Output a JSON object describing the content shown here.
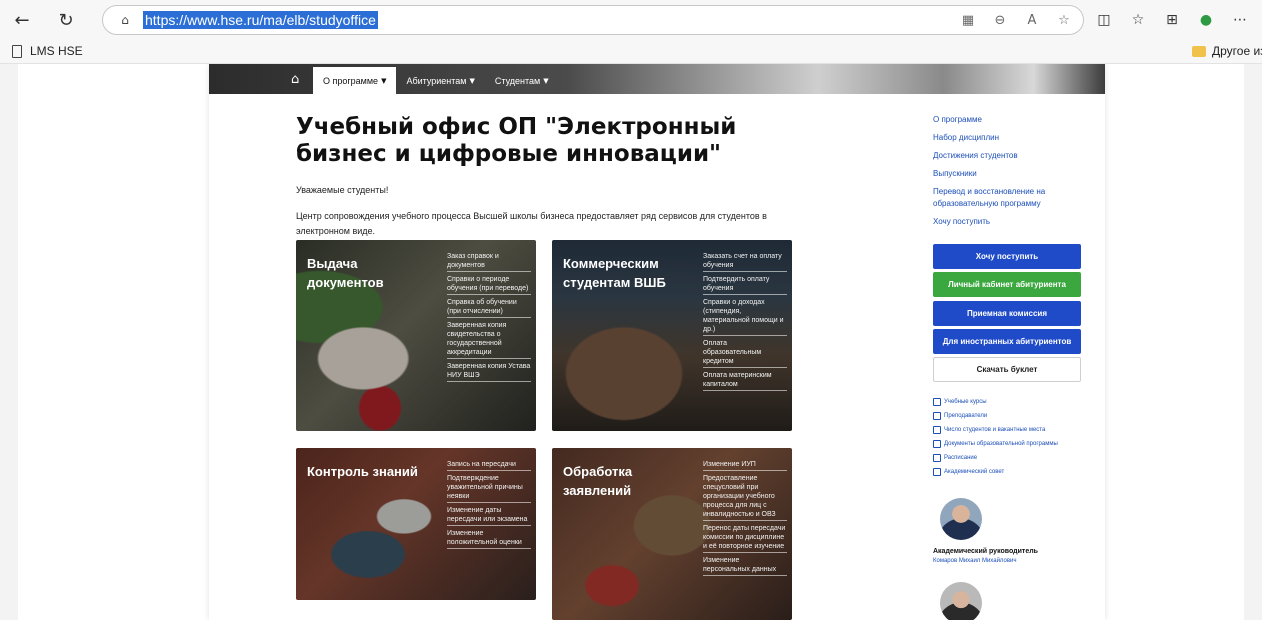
{
  "browser": {
    "url": "https://www.hse.ru/ma/elb/studyoffice",
    "bookmark_left": "LMS HSE",
    "bookmark_right": "Другое изб"
  },
  "site": {
    "nav": {
      "items": [
        {
          "label": "О программе"
        },
        {
          "label": "Абитуриентам"
        },
        {
          "label": "Студентам"
        }
      ]
    },
    "title": "Учебный офис ОП \"Электронный бизнес и цифровые инновации\"",
    "greeting": "Уважаемые студенты!",
    "intro": "Центр сопровождения учебного процесса Высшей школы бизнеса предоставляет ряд сервисов для студентов в электронном виде.",
    "cards": [
      {
        "title": "Выдача документов",
        "links": [
          "Заказ справок и документов",
          "Справки о периоде обучения (при переводе)",
          "Справка об обучении (при отчислении)",
          "Заверенная копия свидетельства о государственной аккредитации",
          "Заверенная копия Устава НИУ ВШЭ"
        ]
      },
      {
        "title": "Коммерческим студентам ВШБ",
        "links": [
          "Заказать счет на оплату обучения",
          "Подтвердить оплату обучения",
          "Справки о доходах (стипендия, материальной помощи и др.)",
          "Оплата образовательным кредитом",
          "Оплата материнским капиталом"
        ]
      },
      {
        "title": "Контроль знаний",
        "links": [
          "Запись на пересдачи",
          "Подтверждение уважительной причины неявки",
          "Изменение даты пересдачи или экзамена",
          "Изменение положительной оценки"
        ]
      },
      {
        "title": "Обработка заявлений",
        "links": [
          "Изменение ИУП",
          "Предоставление спецусловий при организации учебного процесса для лиц с инвалидностью и ОВЗ",
          "Перенос даты пересдачи комиссии по дисциплине и её повторное изучение",
          "Изменение персональных данных"
        ]
      }
    ],
    "sidebar": {
      "links": [
        "О программе",
        "Набор дисциплин",
        "Достижения студентов",
        "Выпускники",
        "Перевод и восстановление на образовательную программу",
        "Хочу поступить"
      ],
      "buttons": [
        "Хочу поступить",
        "Личный кабинет абитуриента",
        "Приемная комиссия",
        "Для иностранных абитуриентов",
        "Скачать буклет"
      ],
      "resources": [
        "Учебные курсы",
        "Преподаватели",
        "Число студентов и вакантные места",
        "Документы образовательной программы",
        "Расписание",
        "Академический совет"
      ],
      "lead_title": "Академический руководитель",
      "lead_name": "Комаров Михаил Михайлович"
    },
    "colors": {
      "accent_blue": "#1f4bc8",
      "accent_green": "#3aa83f",
      "link_blue": "#1c4fb8"
    }
  }
}
